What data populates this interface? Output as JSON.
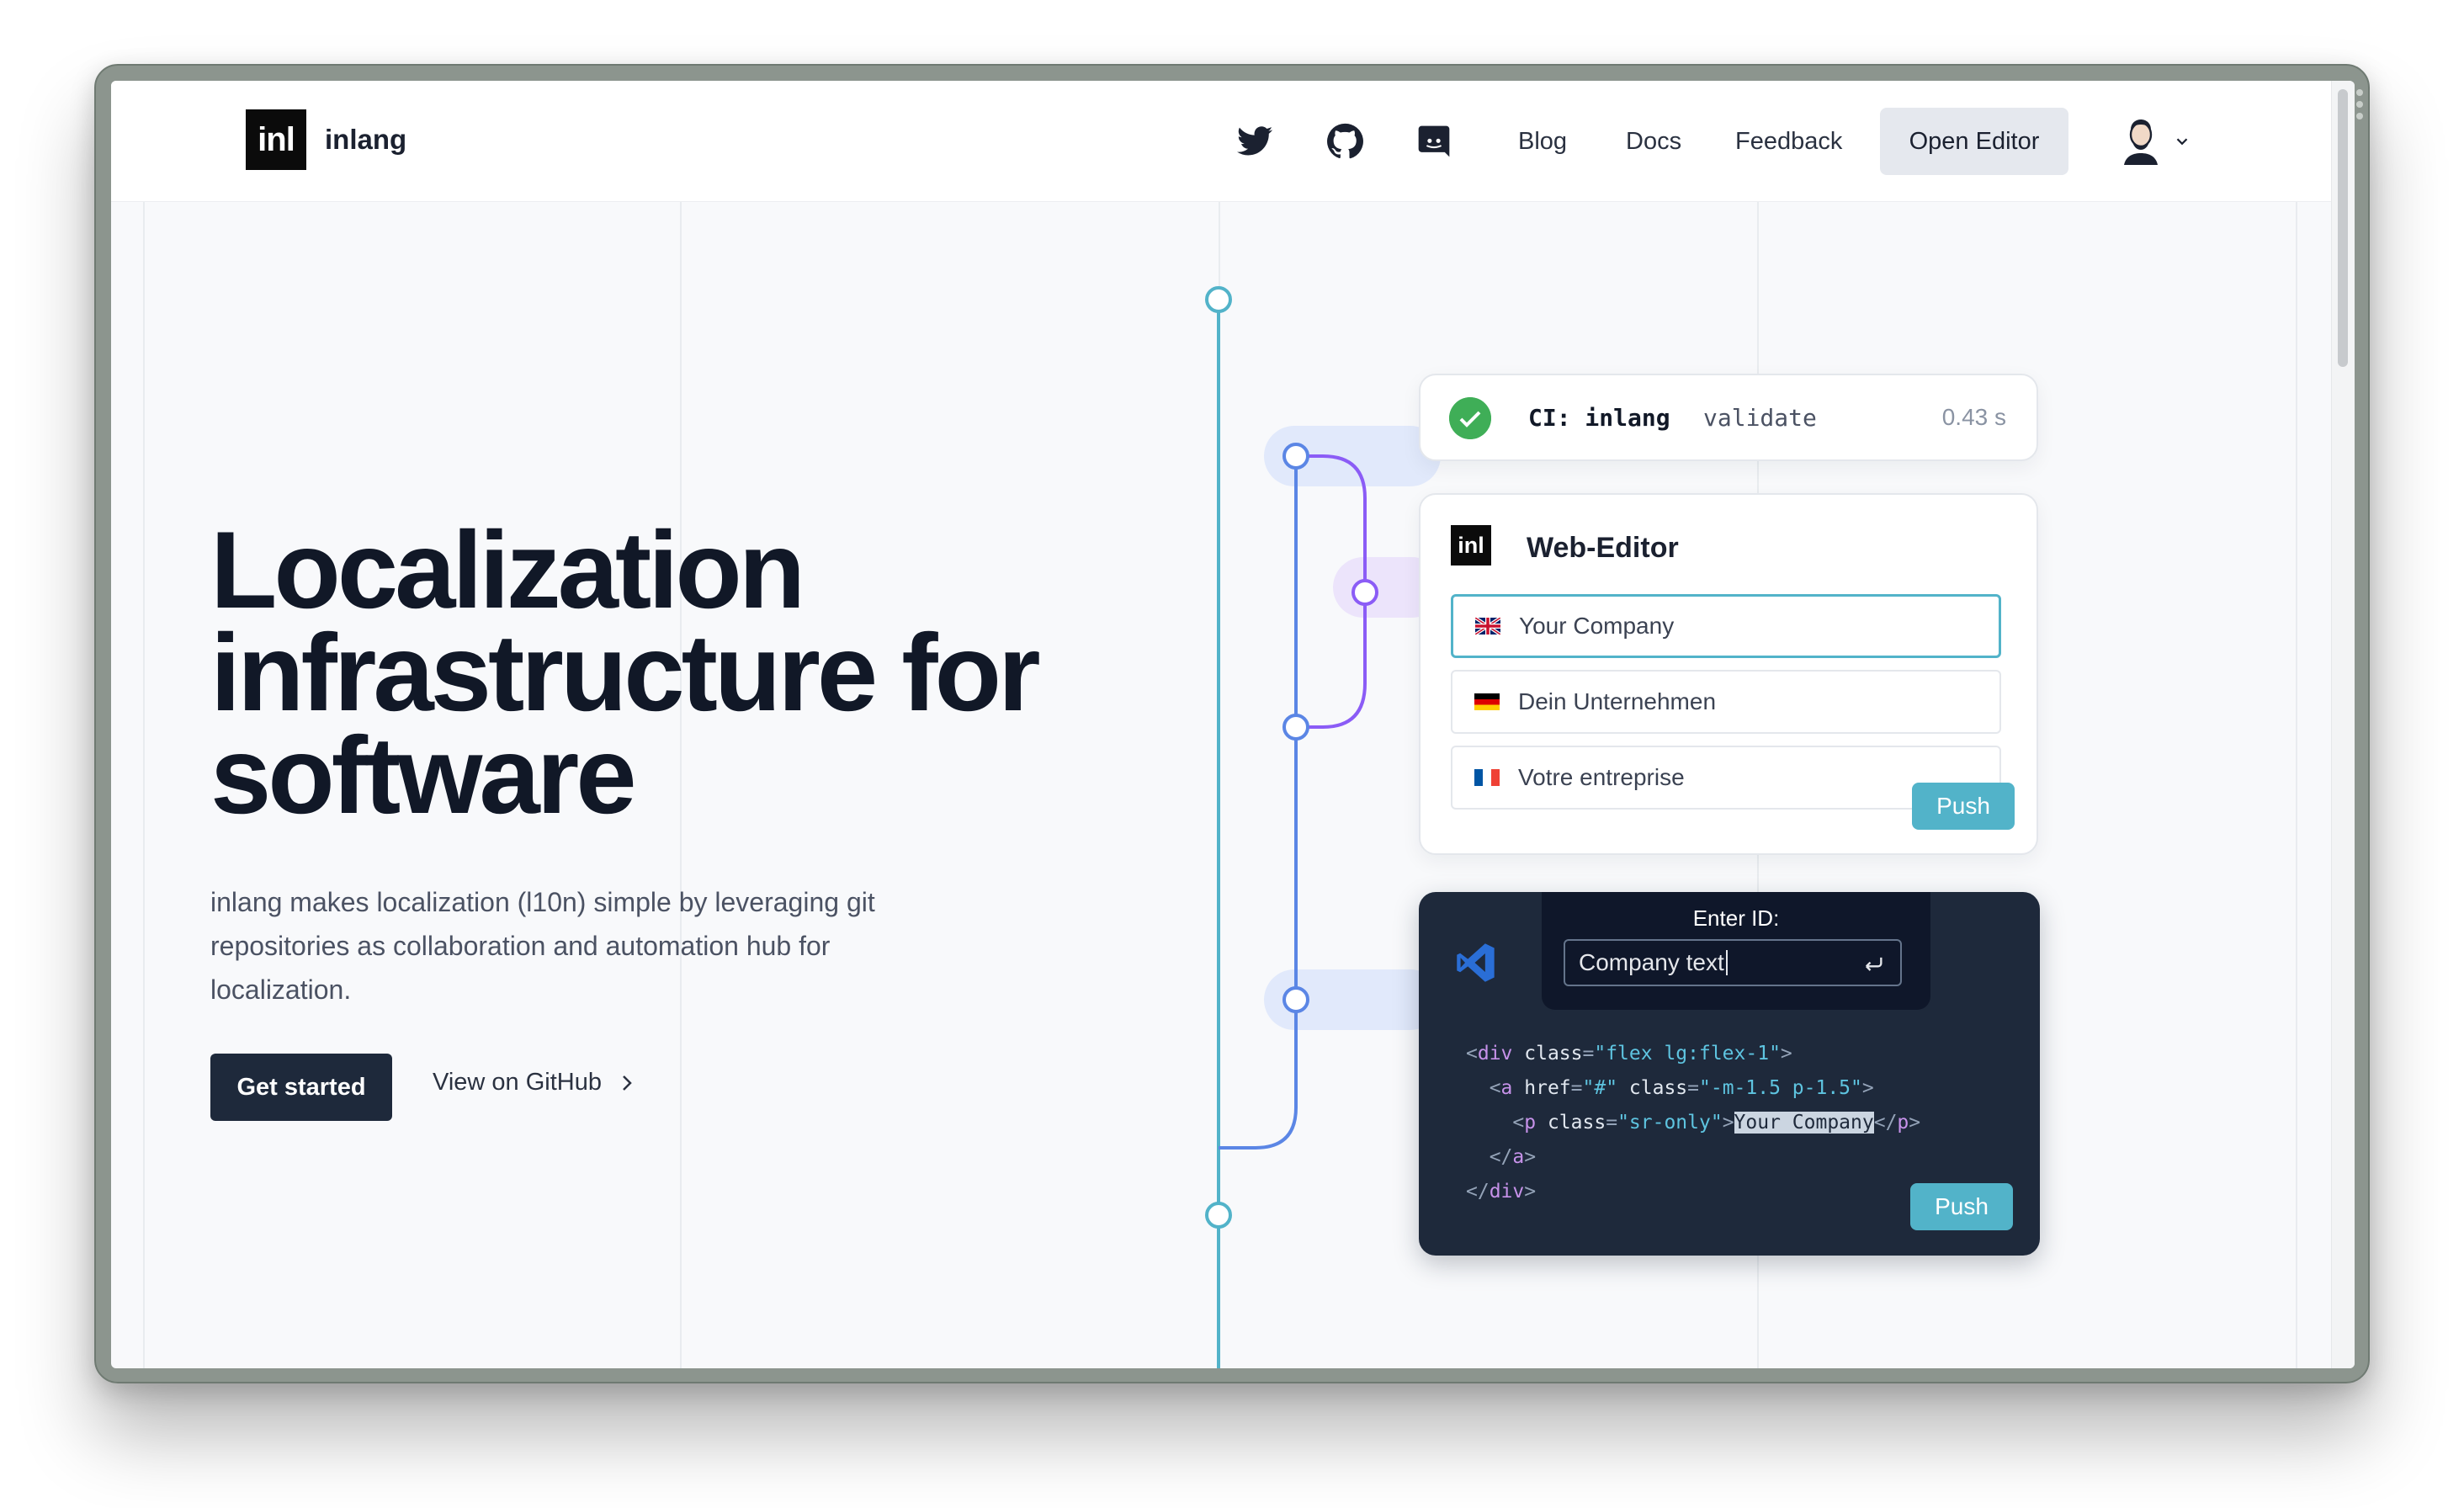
{
  "nav": {
    "logo_mark": "inl",
    "logo_text": "inlang",
    "icons": [
      "twitter-icon",
      "github-icon",
      "discord-icon"
    ],
    "links": [
      "Blog",
      "Docs",
      "Feedback"
    ],
    "cta": "Open Editor"
  },
  "hero": {
    "title": "Localization infrastructure for software",
    "description": "inlang makes localization (l10n) simple by leveraging git repositories as collaboration and automation hub for localization.",
    "primary_button": "Get started",
    "secondary_button": "View on GitHub"
  },
  "ci_card": {
    "label": "CI: inlang",
    "command": "validate",
    "time": "0.43 s"
  },
  "web_editor": {
    "logo_mark": "inl",
    "title": "Web-Editor",
    "fields": [
      {
        "flag": "uk-flag-icon",
        "value": "Your Company"
      },
      {
        "flag": "germany-flag-icon",
        "value": "Dein Unternehmen"
      },
      {
        "flag": "france-flag-icon",
        "value": "Votre entreprise"
      }
    ],
    "push_label": "Push"
  },
  "code_editor": {
    "enter_label": "Enter ID:",
    "input_value": "Company text",
    "code_lines": {
      "l1_open": "<",
      "l1_tag": "div",
      "l1_attr": " class",
      "l1_eq": "=",
      "l1_str": "\"flex lg:flex-1\"",
      "l1_close": ">",
      "l2_open": "  <",
      "l2_tag": "a",
      "l2_attr1": " href",
      "l2_eq1": "=",
      "l2_str1": "\"#\"",
      "l2_attr2": " class",
      "l2_eq2": "=",
      "l2_str2": "\"-m-1.5 p-1.5\"",
      "l2_close": ">",
      "l3_open": "    <",
      "l3_tag": "p",
      "l3_attr": " class",
      "l3_eq": "=",
      "l3_str": "\"sr-only\"",
      "l3_gt": ">",
      "l3_text": "Your Company",
      "l3_end_open": "</",
      "l3_end_tag": "p",
      "l3_end_close": ">",
      "l4_open": "  </",
      "l4_tag": "a",
      "l4_close": ">",
      "l5_open": "</",
      "l5_tag": "div",
      "l5_close": ">"
    },
    "push_label": "Push"
  },
  "colors": {
    "accent": "#52b3c9",
    "dark": "#1e293b",
    "branch_blue": "#5b86e5",
    "branch_purple": "#8b5cf6",
    "success": "#3fae57"
  }
}
